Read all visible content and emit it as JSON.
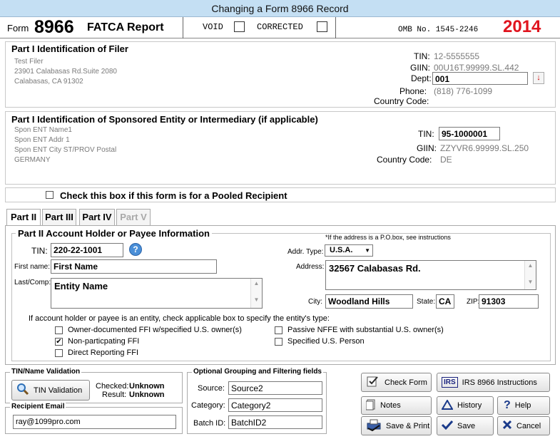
{
  "window": {
    "title": "Changing a Form 8966 Record"
  },
  "header": {
    "form_word": "Form",
    "form_number": "8966",
    "form_title": "FATCA Report",
    "void_label": "VOID",
    "corrected_label": "CORRECTED",
    "omb": "OMB No. 1545-2246",
    "year": "2014",
    "year_color": "#e0141e"
  },
  "filer": {
    "heading": "Part I   Identification of Filer",
    "name": "Test Filer",
    "address1": "23901 Calabasas Rd.Suite 2080",
    "address2": "Calabasas, CA 91302",
    "tin_label": "TIN:",
    "tin": "12-5555555",
    "giin_label": "GIIN:",
    "giin": "00U16T.99999.SL.442",
    "dept_label": "Dept:",
    "dept": "001",
    "phone_label": "Phone:",
    "phone": "(818) 776-1099",
    "country_label": "Country Code:",
    "country": ""
  },
  "sponsor": {
    "heading": "Part I   Identification of Sponsored Entity or Intermediary (if applicable)",
    "name": "Spon ENT Name1",
    "address1": "Spon ENT Addr 1",
    "city": "Spon ENT City ST/PROV Postal",
    "country_name": "GERMANY",
    "tin_label": "TIN:",
    "tin": "95-1000001",
    "giin_label": "GIIN:",
    "giin": "ZZYVR6.99999.SL.250",
    "country_label": "Country Code:",
    "country": "DE"
  },
  "pooled": {
    "label": "Check this box if this form is for a Pooled Recipient"
  },
  "tabs": [
    {
      "label": "Part II"
    },
    {
      "label": "Part III"
    },
    {
      "label": "Part IV"
    },
    {
      "label": "Part V"
    }
  ],
  "part2": {
    "heading": "Part II  Account Holder or Payee Information",
    "po_note": "*If the address is a P.O.box, see instructions",
    "tin_label": "TIN:",
    "tin": "220-22-1001",
    "first_name_label": "First name:",
    "first_name": "First Name",
    "last_label": "Last/Comp:",
    "last": "Entity Name",
    "addr_type_label": "Addr. Type:",
    "addr_type": "U.S.A.",
    "address_label": "Address:",
    "address": "32567 Calabasas Rd.",
    "city_label": "City:",
    "city": "Woodland Hills",
    "state_label": "State:",
    "state": "CA",
    "zip_label": "ZIP:",
    "zip": "91303",
    "entity_note": "If account holder or payee is an entity, check applicable box to specify the entity's type:",
    "options": [
      {
        "label": "Owner-documented FFI w/specified U.S. owner(s)",
        "checked": false
      },
      {
        "label": "Non-particpating FFI",
        "checked": true
      },
      {
        "label": "Direct Reporting FFI",
        "checked": false
      },
      {
        "label": "Passive NFFE with substantial U.S. owner(s)",
        "checked": false
      },
      {
        "label": "Specified U.S. Person",
        "checked": false
      }
    ]
  },
  "tin_validation": {
    "title": "TIN/Name Validation",
    "button": "TIN Validation",
    "checked_label": "Checked:",
    "checked": "Unknown",
    "result_label": "Result:",
    "result": "Unknown"
  },
  "email": {
    "title": "Recipient Email",
    "value": "ray@1099pro.com"
  },
  "grouping": {
    "title": "Optional Grouping and Filtering fields",
    "source_label": "Source:",
    "source": "Source2",
    "category_label": "Category:",
    "category": "Category2",
    "batch_label": "Batch ID:",
    "batch": "BatchID2"
  },
  "buttons": {
    "check_form": "Check Form",
    "irs_badge": "IRS",
    "instructions": "IRS 8966 Instructions",
    "notes": "Notes",
    "history": "History",
    "help": "Help",
    "save_print": "Save & Print",
    "save": "Save",
    "cancel": "Cancel"
  }
}
